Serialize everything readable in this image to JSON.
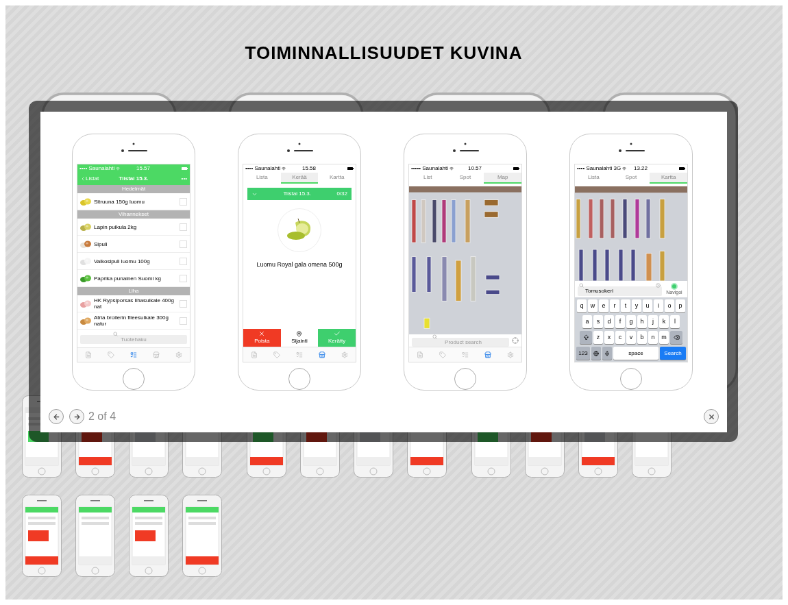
{
  "page": {
    "title": "TOIMINNALLISUUDET KUVINA"
  },
  "lightbox": {
    "counter": "2 of 4",
    "screens": [
      {
        "kind": "list",
        "status": {
          "carrier": "•••• Saunalahti",
          "time": "15.57"
        },
        "nav": {
          "back": "Listat",
          "title": "Tiistai 15.3.",
          "more": "•••"
        },
        "sections": [
          {
            "header": "Hedelmät",
            "items": [
              {
                "name": "Sitruuna 150g luomu",
                "checked": false
              }
            ]
          },
          {
            "header": "Vihannekset",
            "items": [
              {
                "name": "Lapin puikula 2kg",
                "checked": false
              },
              {
                "name": "Sipuli",
                "checked": false
              },
              {
                "name": "Valkosipuli luomu 100g",
                "checked": false
              },
              {
                "name": "Paprika punainen Suomi kg",
                "checked": false
              }
            ]
          },
          {
            "header": "Liha",
            "items": [
              {
                "name": "HK Rypsiporsas lihasuikale 400g nat",
                "checked": false
              },
              {
                "name": "Atria broilerin fileesuikale 300g natur",
                "checked": false
              }
            ]
          }
        ],
        "search_placeholder": "Tuotehaku",
        "tabbar": [
          {
            "selected": false
          },
          {
            "selected": false
          },
          {
            "selected": true
          },
          {
            "selected": false
          },
          {
            "selected": false
          }
        ]
      },
      {
        "kind": "collect",
        "status": {
          "carrier": "•••• Saunalahti",
          "time": "15.58"
        },
        "tabs": [
          {
            "label": "Lista",
            "selected": false
          },
          {
            "label": "Kerää",
            "selected": true
          },
          {
            "label": "Kartta",
            "selected": false
          }
        ],
        "banner": {
          "title": "Tiistai 15.3.",
          "count": "0/32"
        },
        "product": "Luomu Royal gala omena 500g",
        "actions": [
          {
            "label": "Poista",
            "kind": "delete"
          },
          {
            "label": "Sijainti",
            "kind": "locate"
          },
          {
            "label": "Kerätty",
            "kind": "done"
          }
        ],
        "tabbar": [
          {
            "selected": false
          },
          {
            "selected": false
          },
          {
            "selected": false
          },
          {
            "selected": true
          },
          {
            "selected": false
          }
        ]
      },
      {
        "kind": "map",
        "status": {
          "carrier": "••••• Saunalahti",
          "time": "10.57"
        },
        "tabs": [
          {
            "label": "List",
            "selected": false
          },
          {
            "label": "Spot",
            "selected": false
          },
          {
            "label": "Map",
            "selected": true
          }
        ],
        "search_placeholder": "Product search",
        "tabbar": [
          {
            "selected": false
          },
          {
            "selected": false
          },
          {
            "selected": false
          },
          {
            "selected": true
          },
          {
            "selected": false
          }
        ]
      },
      {
        "kind": "map_search",
        "status": {
          "carrier": "•••• Saunalahti 3G",
          "time": "13.22"
        },
        "tabs": [
          {
            "label": "Lista",
            "selected": false
          },
          {
            "label": "Spot",
            "selected": false
          },
          {
            "label": "Kartta",
            "selected": true
          }
        ],
        "search_value": "Tomusokeri",
        "navigate": "Navigoi",
        "keyboard": [
          [
            {
              "kind": "letter",
              "label": "q"
            },
            {
              "kind": "letter",
              "label": "w"
            },
            {
              "kind": "letter",
              "label": "e"
            },
            {
              "kind": "letter",
              "label": "r"
            },
            {
              "kind": "letter",
              "label": "t"
            },
            {
              "kind": "letter",
              "label": "y"
            },
            {
              "kind": "letter",
              "label": "u"
            },
            {
              "kind": "letter",
              "label": "i"
            },
            {
              "kind": "letter",
              "label": "o"
            },
            {
              "kind": "letter",
              "label": "p"
            }
          ],
          [
            {
              "kind": "letter",
              "label": "a"
            },
            {
              "kind": "letter",
              "label": "s"
            },
            {
              "kind": "letter",
              "label": "d"
            },
            {
              "kind": "letter",
              "label": "f"
            },
            {
              "kind": "letter",
              "label": "g"
            },
            {
              "kind": "letter",
              "label": "h"
            },
            {
              "kind": "letter",
              "label": "j"
            },
            {
              "kind": "letter",
              "label": "k"
            },
            {
              "kind": "letter",
              "label": "l"
            }
          ],
          [
            {
              "kind": "shift"
            },
            {
              "kind": "letter",
              "label": "z"
            },
            {
              "kind": "letter",
              "label": "x"
            },
            {
              "kind": "letter",
              "label": "c"
            },
            {
              "kind": "letter",
              "label": "v"
            },
            {
              "kind": "letter",
              "label": "b"
            },
            {
              "kind": "letter",
              "label": "n"
            },
            {
              "kind": "letter",
              "label": "m"
            },
            {
              "kind": "backspace"
            }
          ],
          [
            {
              "kind": "function",
              "label": "123"
            },
            {
              "kind": "globe"
            },
            {
              "kind": "mic"
            },
            {
              "kind": "space",
              "label": "space"
            },
            {
              "kind": "action",
              "label": "Search"
            }
          ]
        ]
      }
    ]
  }
}
